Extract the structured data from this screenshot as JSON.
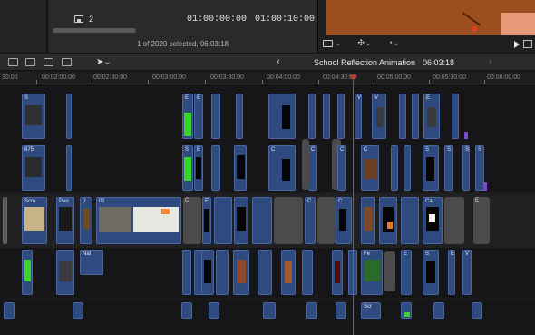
{
  "viewer": {
    "clip_count": "2",
    "timecode_start": "01:00:00:00",
    "timecode_end": "01:00:10:00",
    "selection_info": "1 of 2020 selected, 06:03:18"
  },
  "toolbar": {
    "project_title": "School Reflection Animation",
    "project_duration": "06:03:18",
    "back_glyph": "‹",
    "forward_glyph": "›"
  },
  "ruler": {
    "labels": [
      "30:00",
      "00:02:00:00",
      "00:02:30:00",
      "00:03:00:00",
      "00:03:30:00",
      "00:04:00:00",
      "00:04:30:00",
      "00:05:00:00",
      "00:05:30:00",
      "00:06:00:00"
    ]
  },
  "clips": {
    "top_row": [
      "S",
      "E",
      "E",
      "V",
      "V",
      "E"
    ],
    "second_row": [
      "875",
      "S",
      "E",
      "C",
      "C",
      "C",
      "C",
      "S",
      "S",
      "S",
      "S"
    ],
    "main_row": [
      "Scre",
      "Pen",
      "0",
      "01",
      "C",
      "E",
      "C",
      "C",
      "Cat",
      "E"
    ],
    "bottom_row": [
      "Nat",
      "Fe",
      "E",
      "S",
      "E",
      "V"
    ],
    "lowest_row": [
      "Scr"
    ]
  },
  "colors": {
    "clip_blue": "#2e4a7e",
    "playhead": "#d23a2c",
    "accent_green": "#3bd42b"
  }
}
